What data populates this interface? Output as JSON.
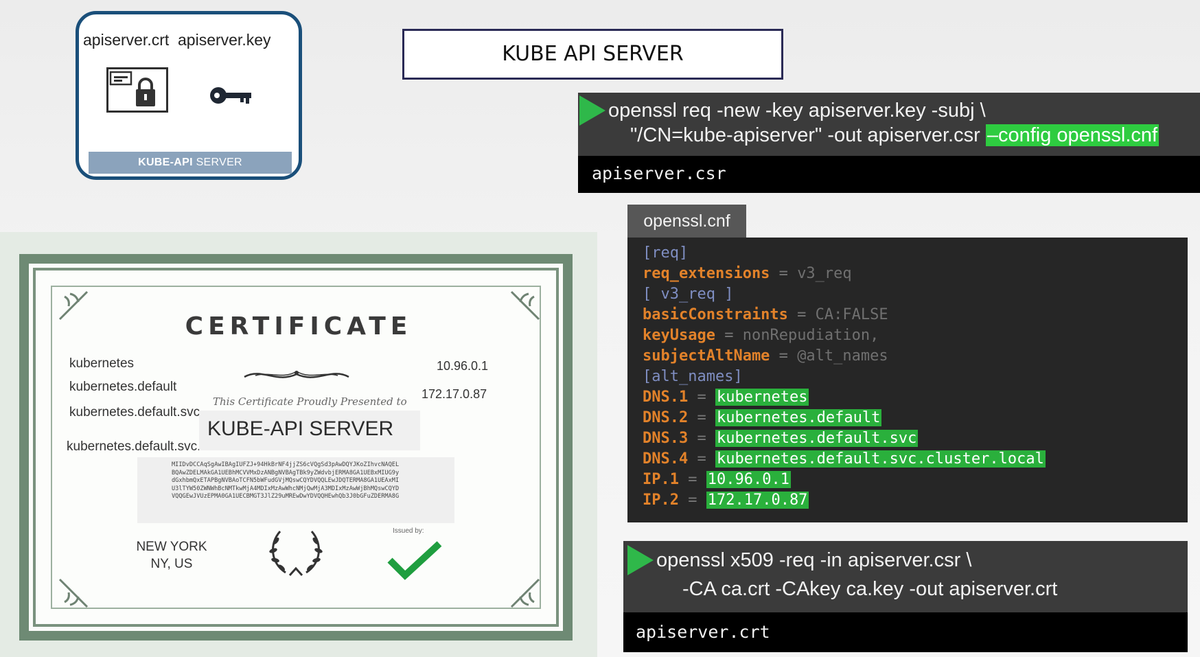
{
  "files_card": {
    "crt_label": "apiserver.crt",
    "key_label": "apiserver.key",
    "crt_icon": "certificate-lock-icon",
    "key_icon": "key-icon",
    "footer_bold": "KUBE-API",
    "footer_rest": " SERVER"
  },
  "title": "KUBE API SERVER",
  "csr_command": {
    "line1": "openssl req -new -key apiserver.key -subj \\",
    "line2": "\"/CN=kube-apiserver\" -out apiserver.csr ",
    "highlight": "–config openssl.cnf",
    "output": "apiserver.csr"
  },
  "cnf": {
    "tab": "openssl.cnf",
    "lines": [
      {
        "section": "[req]"
      },
      {
        "key": "req_extensions",
        "op": " = ",
        "val": "v3_req"
      },
      {
        "section": "[ v3_req ]"
      },
      {
        "key": "basicConstraints",
        "op": " = ",
        "val": "CA:FALSE"
      },
      {
        "key": "keyUsage",
        "op": " = ",
        "val": "nonRepudiation,"
      },
      {
        "key": "subjectAltName",
        "op": " = ",
        "val": "@alt_names"
      },
      {
        "section": "[alt_names]"
      },
      {
        "key": "DNS.1",
        "op": " = ",
        "hval": "kubernetes"
      },
      {
        "key": "DNS.2",
        "op": " = ",
        "hval": "kubernetes.default"
      },
      {
        "key": "DNS.3",
        "op": " = ",
        "hval": "kubernetes.default.svc"
      },
      {
        "key": "DNS.4",
        "op": " = ",
        "hval": "kubernetes.default.svc.cluster.local"
      },
      {
        "key": "IP.1",
        "op": " = ",
        "hval": "10.96.0.1"
      },
      {
        "key": "IP.2",
        "op": " = ",
        "hval": "172.17.0.87"
      }
    ]
  },
  "sign_command": {
    "line1": "openssl x509 -req -in apiserver.csr \\",
    "line2": "-CA ca.crt -CAkey ca.key -out apiserver.crt",
    "output": "apiserver.crt"
  },
  "certificate": {
    "title": "CERTIFICATE",
    "dns_names": [
      "kubernetes",
      "kubernetes.default",
      "kubernetes.default.svc",
      "kubernetes.default.svc.cluster.local"
    ],
    "ips": [
      "10.96.0.1",
      "172.17.0.87"
    ],
    "presented": "This Certificate Proudly Presented to",
    "subject": "KUBE-API SERVER",
    "key_text": "MIIDvDCCAqSgAwIBAgIUFZJ+94HkBrNF4jjZS6cVQgSd3pAwDQYJKoZIhvcNAQEL\nBQAwZDELMAkGA1UEBhMCVVMxDzANBgNVBAgTBk9yZWdvbjERMA8GA1UEBxMIUG9y\ndGxhbmQxETAPBgNVBAoTCFN5bWFudGVjMQswCQYDVQQLEwJDQTERMA8GA1UEAxMI\nU3lTYW50ZWNWhBcNMTkwMjA4MDIxMzAwWhcNMjQwMjA3MDIxMzAwWjBhMQswCQYD\nVQQGEwJVUzEPMA0GA1UECBMGT3JlZ29uMREwDwYDVQQHEwhQb3J0bGFuZDERMA8G",
    "issued_by": "Issued by:",
    "city_line1": "NEW YORK",
    "city_line2": "NY, US"
  }
}
